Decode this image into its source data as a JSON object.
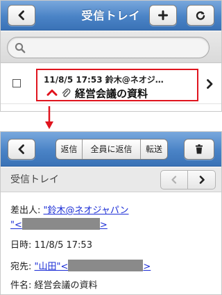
{
  "inbox": {
    "title": "受信トレイ",
    "back_icon": "chevron-left-icon",
    "compose_icon": "plus-icon",
    "refresh_icon": "refresh-icon",
    "search_icon": "search-icon",
    "search_placeholder": "",
    "message": {
      "meta": "11/8/5 17:53  鈴木@ネオジ…",
      "subject": "経営会議の資料",
      "flag_icon": "high-priority-chevron-up-icon",
      "attachment_icon": "paperclip-icon",
      "open_icon": "chevron-right-icon"
    }
  },
  "detail": {
    "toolbar": {
      "back_icon": "chevron-left-icon",
      "reply_label": "返信",
      "reply_all_label": "全員に返信",
      "forward_label": "転送",
      "delete_icon": "trash-icon"
    },
    "folder_title": "受信トレイ",
    "pager": {
      "prev_icon": "chevron-left-icon",
      "next_icon": "chevron-right-icon"
    },
    "from_label": "差出人:",
    "from_name": "\"鈴木@ネオジャパン",
    "from_addr_open": "\"<",
    "from_addr_close": ">",
    "date_label": "日時:",
    "date_value": "11/8/5 17:53",
    "to_label": "宛先:",
    "to_name": "\"山田\"<",
    "to_addr_close": ">",
    "subject_label": "件名:",
    "subject_value": "経営会議の資料"
  },
  "colors": {
    "navbar": "#4a83c6",
    "highlight": "#e0141e",
    "link": "#1a2cd6",
    "flag": "#e0141e"
  }
}
